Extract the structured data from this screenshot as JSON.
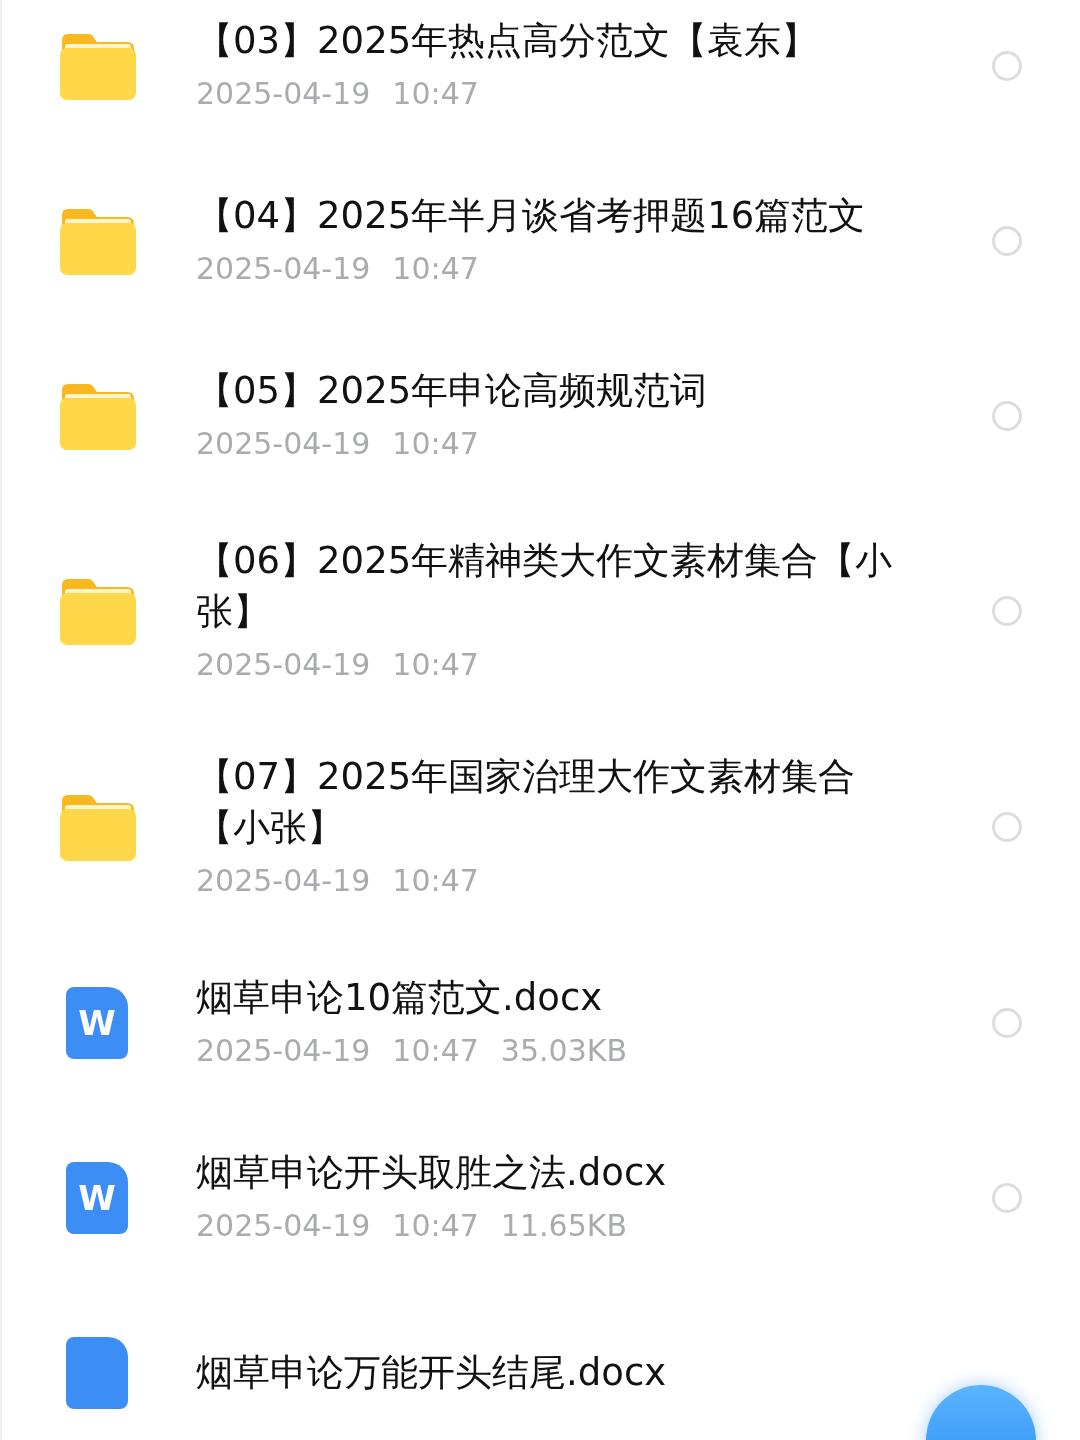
{
  "files": [
    {
      "kind": "folder",
      "name": "【03】2025年热点高分范文【袁东】",
      "date": "2025-04-19",
      "time": "10:47",
      "selected": false
    },
    {
      "kind": "folder",
      "name": "【04】2025年半月谈省考押题16篇范文",
      "date": "2025-04-19",
      "time": "10:47",
      "selected": false
    },
    {
      "kind": "folder",
      "name": "【05】2025年申论高频规范词",
      "date": "2025-04-19",
      "time": "10:47",
      "selected": false
    },
    {
      "kind": "folder",
      "name": "【06】2025年精神类大作文素材集合【小张】",
      "date": "2025-04-19",
      "time": "10:47",
      "selected": false
    },
    {
      "kind": "folder",
      "name": "【07】2025年国家治理大作文素材集合【小张】",
      "date": "2025-04-19",
      "time": "10:47",
      "selected": false
    },
    {
      "kind": "doc",
      "icon_letter": "W",
      "name": "烟草申论10篇范文.docx",
      "date": "2025-04-19",
      "time": "10:47",
      "size": "35.03KB",
      "selected": false
    },
    {
      "kind": "doc",
      "icon_letter": "W",
      "name": "烟草申论开头取胜之法.docx",
      "date": "2025-04-19",
      "time": "10:47",
      "size": "11.65KB",
      "selected": false
    },
    {
      "kind": "doc",
      "name": "烟草申论万能开头结尾.docx"
    }
  ],
  "floating_button": {
    "kind": "action"
  }
}
